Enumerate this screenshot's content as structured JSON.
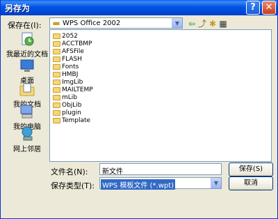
{
  "window": {
    "title": "另存为",
    "help_glyph": "?",
    "close_glyph": "✕"
  },
  "location": {
    "label": "保存在(I):",
    "value": "WPS Office 2002"
  },
  "places": [
    {
      "label": "我最近的文档"
    },
    {
      "label": "桌面"
    },
    {
      "label": "我的文档"
    },
    {
      "label": "我的电脑"
    },
    {
      "label": "网上邻居"
    }
  ],
  "files": [
    "2052",
    "ACCTBMP",
    "AFSFile",
    "FLASH",
    "Fonts",
    "HMBJ",
    "ImgLib",
    "MAILTEMP",
    "mLib",
    "ObjLib",
    "plugin",
    "Template"
  ],
  "filename": {
    "label": "文件名(N):",
    "value": "新文件"
  },
  "filetype": {
    "label": "保存类型(T):",
    "value": "WPS 模板文件 (*.wpt)"
  },
  "buttons": {
    "save": "保存(S)",
    "cancel": "取消"
  },
  "colors": {
    "titlebar": "#0055e5",
    "dialog": "#ece9d8",
    "selection": "#316ac5"
  }
}
